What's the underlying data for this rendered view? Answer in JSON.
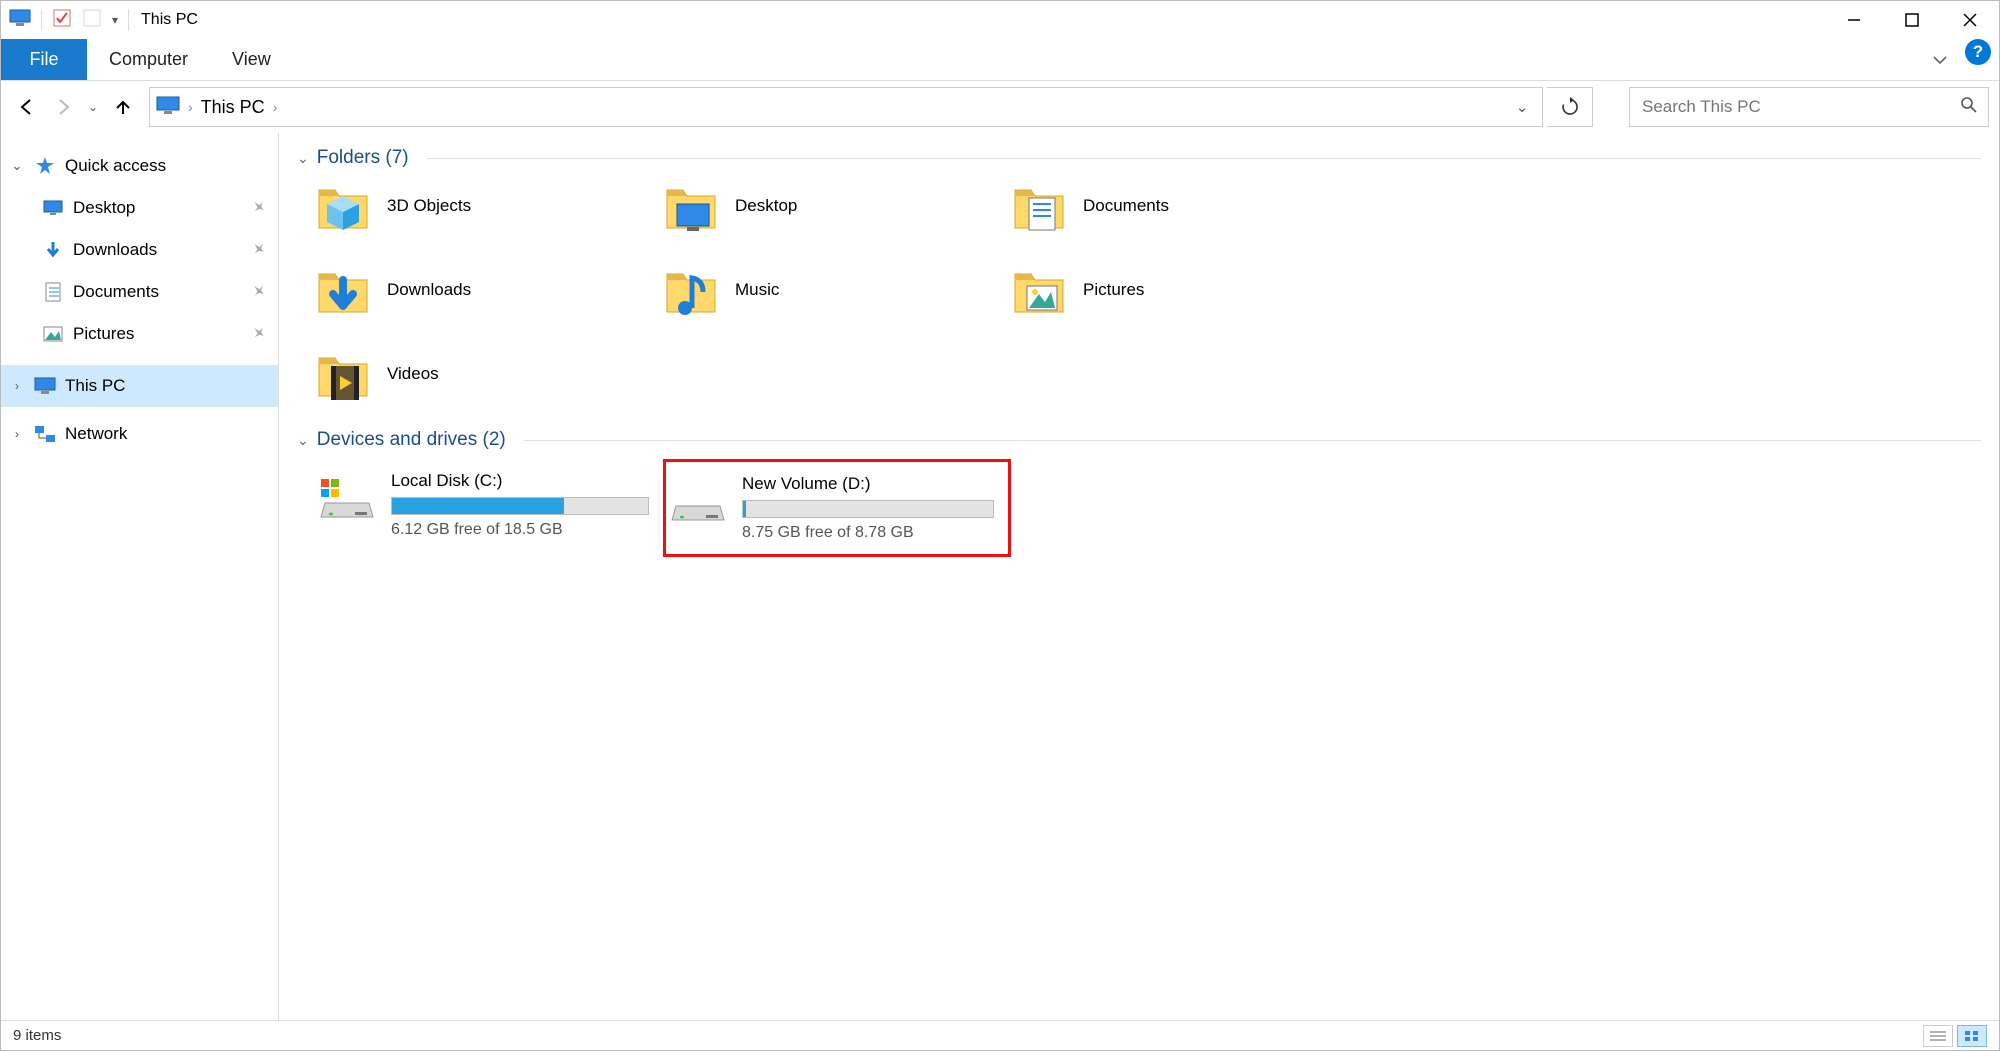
{
  "titlebar": {
    "title": "This PC"
  },
  "ribbon": {
    "file": "File",
    "tabs": [
      "Computer",
      "View"
    ]
  },
  "nav": {
    "back_enabled": true,
    "forward_enabled": false
  },
  "address": {
    "location": "This PC",
    "search_placeholder": "Search This PC"
  },
  "navpane": {
    "quick_access": {
      "label": "Quick access",
      "expanded": true
    },
    "quick_items": [
      {
        "label": "Desktop",
        "pinned": true,
        "icon": "desktop"
      },
      {
        "label": "Downloads",
        "pinned": true,
        "icon": "downloads"
      },
      {
        "label": "Documents",
        "pinned": true,
        "icon": "documents"
      },
      {
        "label": "Pictures",
        "pinned": true,
        "icon": "pictures"
      }
    ],
    "this_pc": {
      "label": "This PC",
      "selected": true
    },
    "network": {
      "label": "Network"
    }
  },
  "sections": {
    "folders": {
      "title": "Folders (7)",
      "items": [
        {
          "label": "3D Objects",
          "icon": "3dobjects"
        },
        {
          "label": "Desktop",
          "icon": "desktop"
        },
        {
          "label": "Documents",
          "icon": "documents"
        },
        {
          "label": "Downloads",
          "icon": "downloads"
        },
        {
          "label": "Music",
          "icon": "music"
        },
        {
          "label": "Pictures",
          "icon": "pictures"
        },
        {
          "label": "Videos",
          "icon": "videos"
        }
      ]
    },
    "drives": {
      "title": "Devices and drives (2)",
      "items": [
        {
          "label": "Local Disk (C:)",
          "free_text": "6.12 GB free of 18.5 GB",
          "used_pct": 67,
          "os": true,
          "highlight": false
        },
        {
          "label": "New Volume (D:)",
          "free_text": "8.75 GB free of 8.78 GB",
          "used_pct": 1,
          "os": false,
          "highlight": true
        }
      ]
    }
  },
  "statusbar": {
    "count_text": "9 items"
  }
}
